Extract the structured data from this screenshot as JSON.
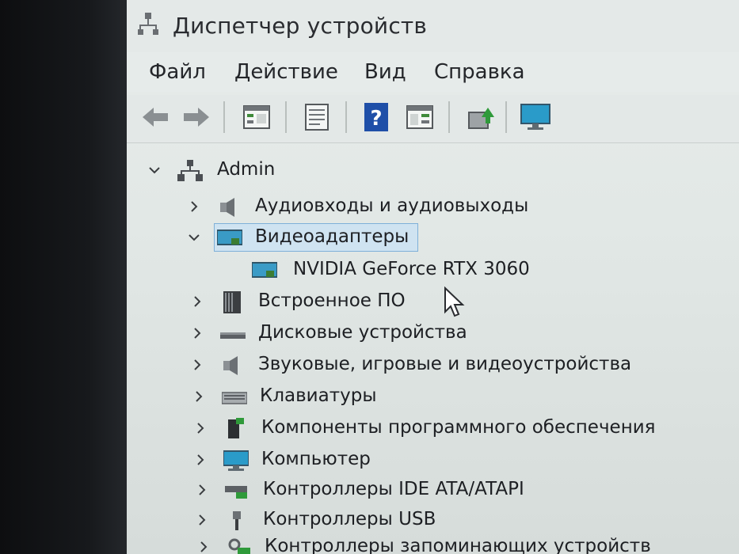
{
  "window": {
    "title": "Диспетчер устройств"
  },
  "menu": [
    "Файл",
    "Действие",
    "Вид",
    "Справка"
  ],
  "toolbar": {
    "buttons": [
      "back-icon",
      "forward-icon",
      "properties-grid-icon",
      "document-icon",
      "help-icon",
      "panel-icon",
      "update-driver-icon",
      "monitor-icon"
    ]
  },
  "tree": {
    "root": {
      "label": "Admin",
      "icon": "computer-tree-icon",
      "expanded": true
    },
    "items": [
      {
        "label": "Аудиовходы и аудиовыходы",
        "icon": "speaker-icon",
        "expanded": false
      },
      {
        "label": "Видеоадаптеры",
        "icon": "display-adapter-icon",
        "expanded": true,
        "selected": true
      },
      {
        "label": "NVIDIA GeForce RTX 3060",
        "icon": "display-adapter-icon",
        "child": true
      },
      {
        "label": "Встроенное ПО",
        "icon": "firmware-icon",
        "expanded": false
      },
      {
        "label": "Дисковые устройства",
        "icon": "disk-icon",
        "expanded": false
      },
      {
        "label": "Звуковые, игровые и видеоустройства",
        "icon": "speaker-icon",
        "expanded": false
      },
      {
        "label": "Клавиатуры",
        "icon": "keyboard-icon",
        "expanded": false
      },
      {
        "label": "Компоненты программного обеспечения",
        "icon": "software-component-icon",
        "expanded": false
      },
      {
        "label": "Компьютер",
        "icon": "computer-icon",
        "expanded": false
      },
      {
        "label": "Контроллеры IDE ATA/ATAPI",
        "icon": "ide-controller-icon",
        "expanded": false
      },
      {
        "label": "Контроллеры USB",
        "icon": "usb-icon",
        "expanded": false
      },
      {
        "label": "Контроллеры запоминающих устройств",
        "icon": "storage-controller-icon",
        "expanded": false
      }
    ]
  },
  "colors": {
    "selection": "#cfe3f1",
    "selection_border": "#7fb0d8"
  }
}
